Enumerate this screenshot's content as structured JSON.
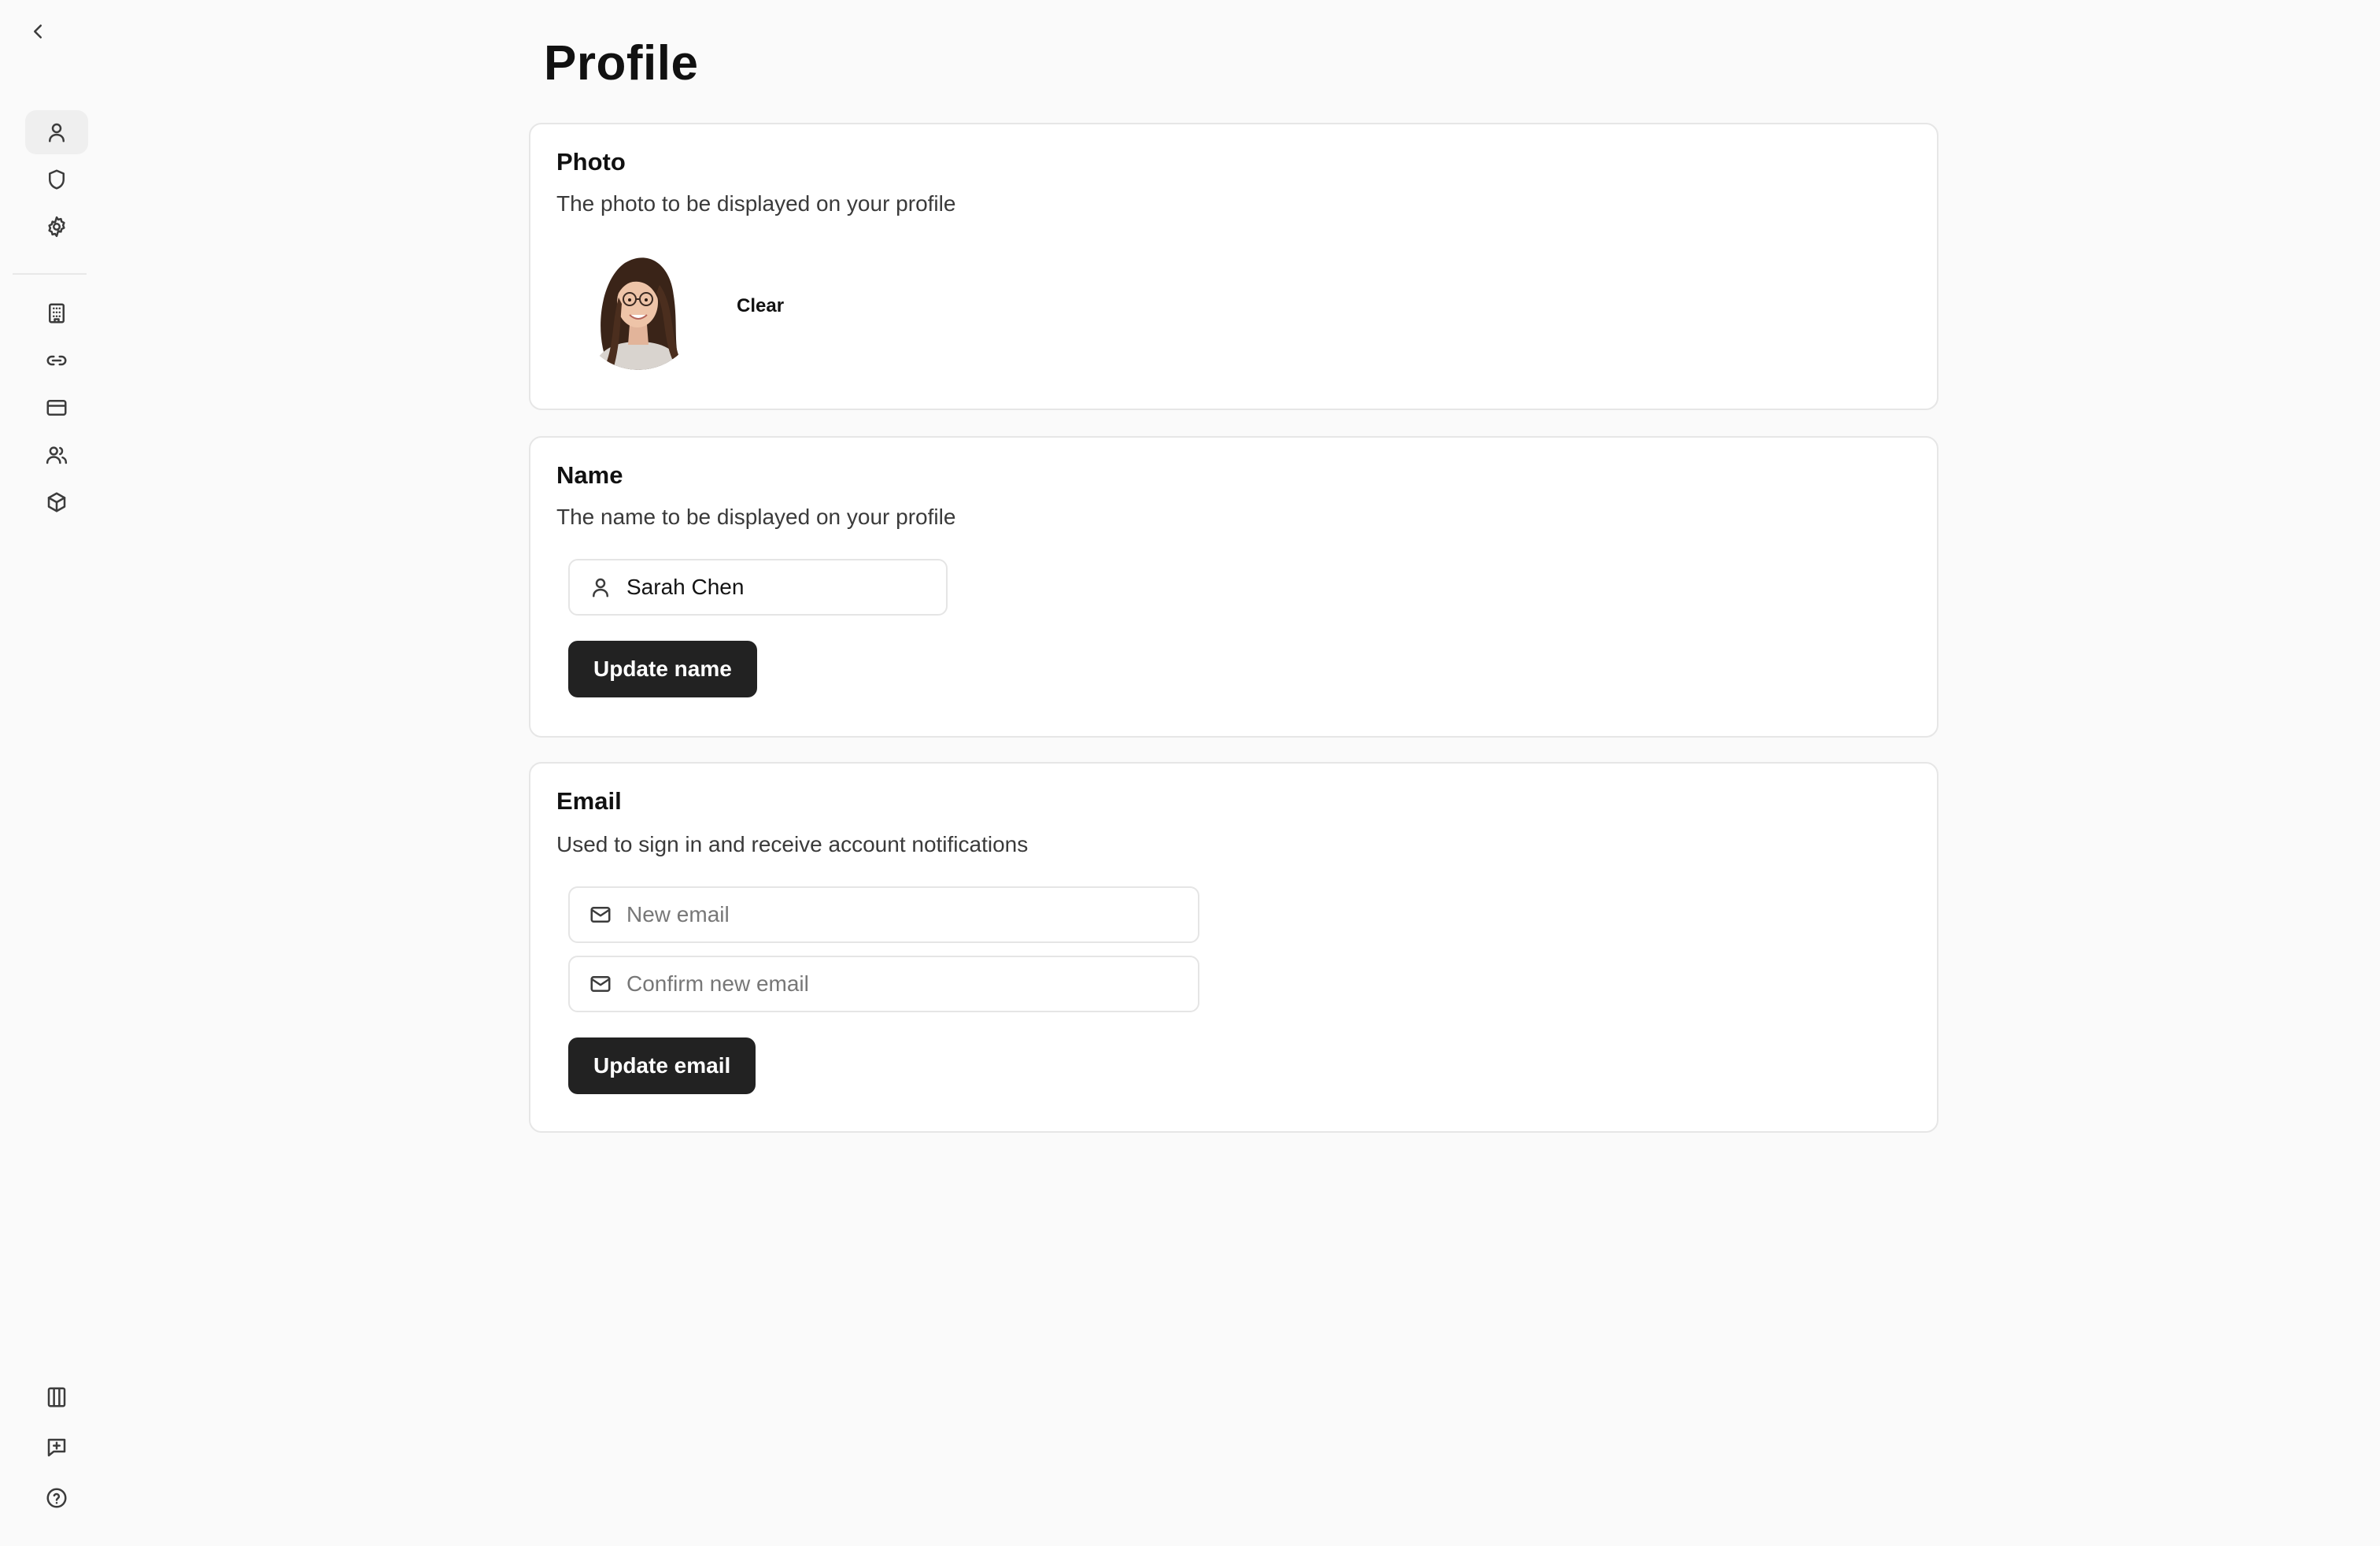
{
  "sidebar": {
    "back_icon": "chevron-left-icon",
    "top_items": [
      {
        "icon": "user-icon",
        "id": "profile",
        "active": true
      },
      {
        "icon": "shield-icon",
        "id": "security"
      },
      {
        "icon": "gear-icon",
        "id": "settings"
      }
    ],
    "middle_items": [
      {
        "icon": "building-icon",
        "id": "organization"
      },
      {
        "icon": "link-icon",
        "id": "connections"
      },
      {
        "icon": "credit-card-icon",
        "id": "billing"
      },
      {
        "icon": "users-icon",
        "id": "members"
      },
      {
        "icon": "box-icon",
        "id": "integrations"
      }
    ],
    "bottom_items": [
      {
        "icon": "columns-icon",
        "id": "layout"
      },
      {
        "icon": "message-plus-icon",
        "id": "feedback"
      },
      {
        "icon": "help-circle-icon",
        "id": "help"
      }
    ]
  },
  "page": {
    "title": "Profile"
  },
  "photo_card": {
    "title": "Photo",
    "description": "The photo to be displayed on your profile",
    "clear_label": "Clear"
  },
  "name_card": {
    "title": "Name",
    "description": "The name to be displayed on your profile",
    "name_value": "Sarah Chen",
    "button_label": "Update name"
  },
  "email_card": {
    "title": "Email",
    "description": "Used to sign in and receive account notifications",
    "new_email_placeholder": "New email",
    "confirm_email_placeholder": "Confirm new email",
    "button_label": "Update email"
  },
  "colors": {
    "background": "#fafafa",
    "card": "#ffffff",
    "border": "#e6e6e6",
    "button_dark": "#222222",
    "active_nav": "#efefef"
  }
}
